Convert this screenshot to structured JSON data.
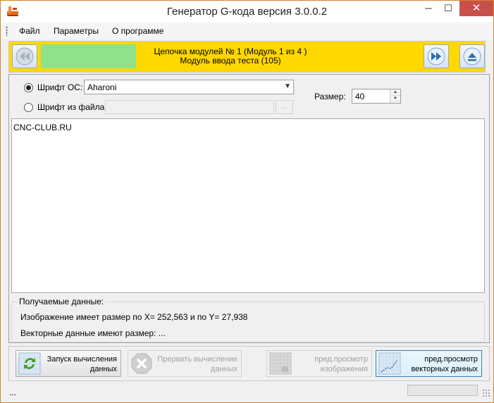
{
  "window": {
    "title": "Генератор G-кода версия 3.0.0.2",
    "minimize_glyph": "─",
    "maximize_glyph": "☐",
    "close_glyph": "✕"
  },
  "menu": {
    "file": "Файл",
    "params": "Параметры",
    "about": "О программе"
  },
  "chain": {
    "line1": "Цепочка модулей № 1 (Модуль 1 из 4 )",
    "line2": "Модуль ввода теста (105)",
    "progress_fraction": 0.25,
    "accent_color": "#ffd800",
    "progress_color": "#8fe28a"
  },
  "font": {
    "os_font_label": "Шрифт ОС:",
    "os_font_selected": true,
    "os_font_value": "Aharoni",
    "file_font_label": "Шрифт из файла:",
    "file_font_value": "",
    "browse_label": "...",
    "size_label": "Размер:",
    "size_value": "40"
  },
  "text": {
    "content": "CNC-CLUB.RU"
  },
  "result": {
    "group_title": "Получаемые данные:",
    "image_size": "Изображение имеет размер по X= 252,563 и по Y= 27,938",
    "vector_size": "Векторные данные имеют размер:  ..."
  },
  "actions": {
    "start_line1": "Запуск вычисления",
    "start_line2": "данных",
    "abort_line1": "Прервать вычисление",
    "abort_line2": "данных",
    "preview_img_line1": "пред.просмотр",
    "preview_img_line2": "изображения",
    "preview_vec_line1": "пред.просмотр",
    "preview_vec_line2": "векторных данных"
  },
  "status": {
    "text": "..."
  },
  "icons": {
    "app": "app-gear-icon",
    "prev": "rewind-icon",
    "next": "fast-forward-icon",
    "eject": "eject-icon",
    "start": "refresh-icon",
    "abort": "stop-icon",
    "preview_img": "image-preview-icon",
    "preview_vec": "vector-preview-icon"
  }
}
